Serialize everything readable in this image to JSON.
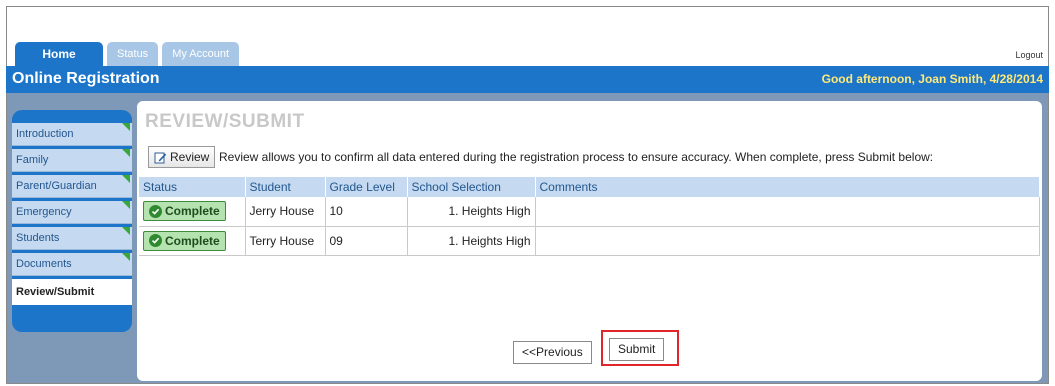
{
  "tabs": [
    {
      "label": "Home",
      "active": true
    },
    {
      "label": "Status",
      "active": false
    },
    {
      "label": "My Account",
      "active": false
    }
  ],
  "logout_label": "Logout",
  "header": {
    "title": "Online Registration",
    "greeting": "Good afternoon, Joan Smith, 4/28/2014"
  },
  "sidebar": {
    "items": [
      {
        "label": "Introduction",
        "done": true
      },
      {
        "label": "Family",
        "done": true
      },
      {
        "label": "Parent/Guardian",
        "done": true
      },
      {
        "label": "Emergency",
        "done": true
      },
      {
        "label": "Students",
        "done": true
      },
      {
        "label": "Documents",
        "done": true
      },
      {
        "label": "Review/Submit",
        "active": true
      }
    ]
  },
  "main": {
    "title": "REVIEW/SUBMIT",
    "review_button": "Review",
    "description": "Review allows you to confirm all data entered during the registration process to ensure accuracy. When complete, press Submit below:",
    "columns": [
      "Status",
      "Student",
      "Grade Level",
      "School Selection",
      "Comments"
    ],
    "rows": [
      {
        "status": "Complete",
        "student": "Jerry House",
        "grade": "10",
        "school": "1.  Heights High",
        "comments": ""
      },
      {
        "status": "Complete",
        "student": "Terry House",
        "grade": "09",
        "school": "1.  Heights High",
        "comments": ""
      }
    ],
    "previous_label": "<<Previous",
    "submit_label": "Submit"
  },
  "colors": {
    "brand_blue": "#1c75c8",
    "greeting_yellow": "#ffe97a",
    "complete_green": "#b4e3b0",
    "highlight_red": "#e0252b"
  }
}
